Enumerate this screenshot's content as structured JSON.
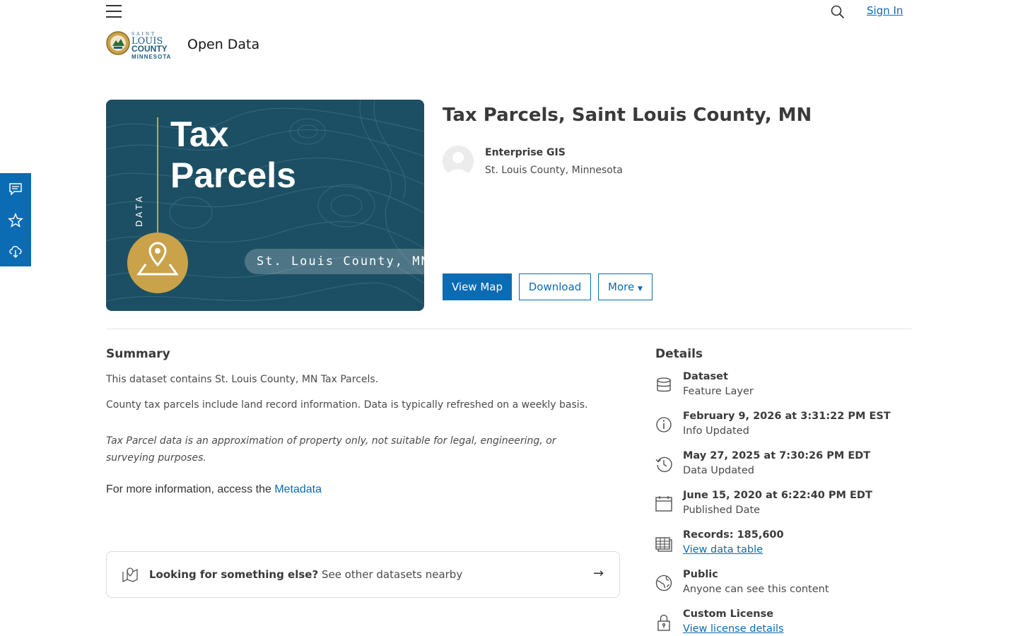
{
  "header": {
    "site_title": "Open Data",
    "sign_in_label": "Sign In",
    "logo": {
      "line1": "SAINT",
      "line2": "LOUIS",
      "line3": "COUNTY",
      "line4": "MINNESOTA"
    }
  },
  "hero": {
    "title_line1": "Tax",
    "title_line2": "Parcels",
    "vertical_label": "DATA",
    "pill_text": "St. Louis County, MN",
    "background_color": "#1c4f63",
    "accent_color": "#c9a24a"
  },
  "item": {
    "title": "Tax Parcels, Saint Louis County, MN",
    "owner_name": "Enterprise GIS",
    "owner_org": "St. Louis County, Minnesota"
  },
  "actions": {
    "view_map": "View Map",
    "download": "Download",
    "more": "More"
  },
  "side_toolbar": {
    "icons": [
      "comment-icon",
      "star-icon",
      "cloud-download-icon"
    ]
  },
  "summary": {
    "heading": "Summary",
    "p1": "This dataset contains St. Louis County, MN Tax Parcels.",
    "p2": "County tax parcels include land record information. Data is typically refreshed on a weekly basis.",
    "p3": "Tax Parcel data is an approximation of property only, not suitable for legal, engineering, or surveying purposes.",
    "p4_prefix": "For more information, access the ",
    "p4_link": "Metadata"
  },
  "nearby": {
    "bold": "Looking for something else?",
    "text": " See other datasets nearby",
    "arrow": "→"
  },
  "details": {
    "heading": "Details",
    "items": [
      {
        "icon": "database-icon",
        "title": "Dataset",
        "sub": "Feature Layer"
      },
      {
        "icon": "info-icon",
        "title": "February 9, 2026 at 3:31:22 PM EST",
        "sub": "Info Updated"
      },
      {
        "icon": "history-icon",
        "title": "May 27, 2025 at 7:30:26 PM EDT",
        "sub": "Data Updated"
      },
      {
        "icon": "calendar-icon",
        "title": "June 15, 2020 at 6:22:40 PM EDT",
        "sub": "Published Date"
      },
      {
        "icon": "table-icon",
        "title": "Records: 185,600",
        "sub": "View data table"
      },
      {
        "icon": "globe-icon",
        "title": "Public",
        "sub": "Anyone can see this content"
      },
      {
        "icon": "lock-icon",
        "title": "Custom License",
        "sub": "View license details"
      }
    ]
  },
  "colors": {
    "brand_blue": "#0b6bb3",
    "text": "#4a4a4a"
  }
}
